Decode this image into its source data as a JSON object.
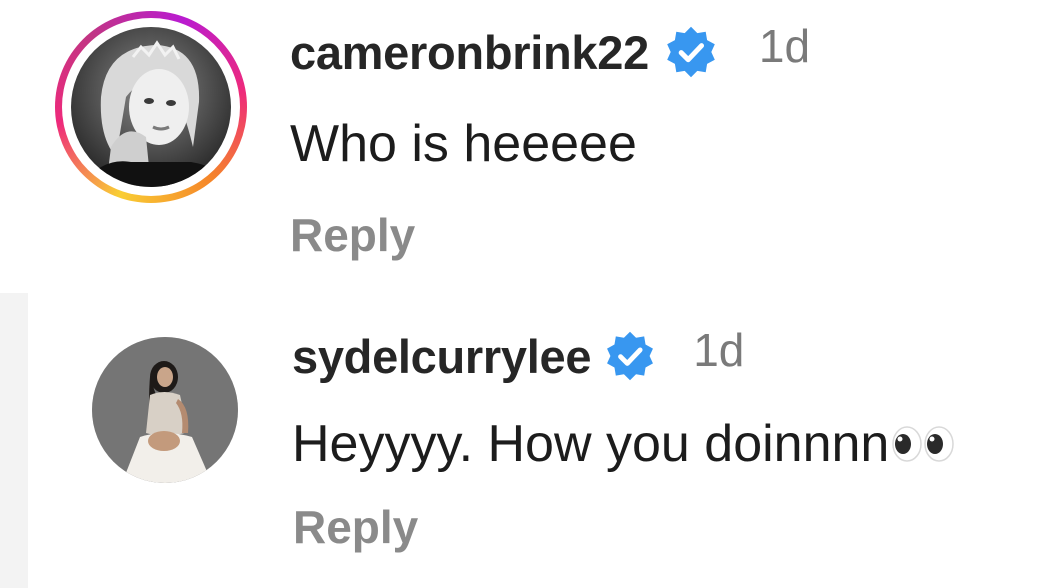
{
  "comments": [
    {
      "username": "cameronbrink22",
      "verified": true,
      "timestamp": "1d",
      "text": "Who is heeeee",
      "reply_label": "Reply",
      "has_story_ring": true
    },
    {
      "username": "sydelcurrylee",
      "verified": true,
      "timestamp": "1d",
      "text": "Heyyyy. How you doinnnn",
      "emoji": "eyes-emoji",
      "reply_label": "Reply",
      "has_story_ring": false
    }
  ],
  "colors": {
    "verified_badge": "#3897f0",
    "username": "#262626",
    "timestamp": "#7a7a7a",
    "reply": "#8a8a8a"
  }
}
